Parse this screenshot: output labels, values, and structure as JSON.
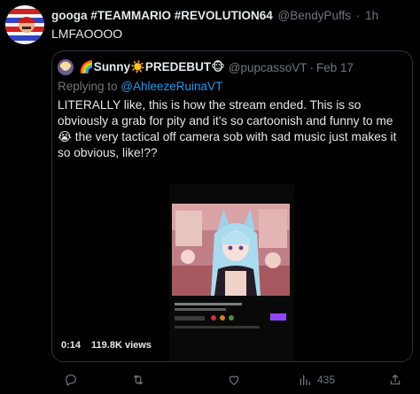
{
  "tweet": {
    "display_name": "googa #TEAMMARIO #REVOLUTION64",
    "handle": "@BendyPuffs",
    "separator": "·",
    "time": "1h",
    "text": "LMFAOOOO"
  },
  "quote": {
    "display_name": "🌈Sunny☀️PREDEBUT🐵",
    "handle": "@pupcassoVT",
    "separator": "·",
    "date": "Feb 17",
    "replying_prefix": "Replying to ",
    "replying_to": "@AhleezeRuinaVT",
    "text": "LITERALLY like, this is how the stream ended. This is so obviously a grab for pity and it's so cartoonish and funny to me 😭 the very tactical off camera sob with sad music just makes it so obvious, like!??",
    "video": {
      "duration": "0:14",
      "views": "119.8K views"
    }
  },
  "actions": {
    "reply_icon": "reply-icon",
    "retweet_icon": "retweet-icon",
    "like_icon": "heart-icon",
    "views_icon": "analytics-icon",
    "views_count": "435",
    "share_icon": "share-icon"
  },
  "colors": {
    "background": "#000000",
    "text": "#e7e9ea",
    "muted": "#71767b",
    "link": "#1d9bf0",
    "border": "#2f3336"
  }
}
